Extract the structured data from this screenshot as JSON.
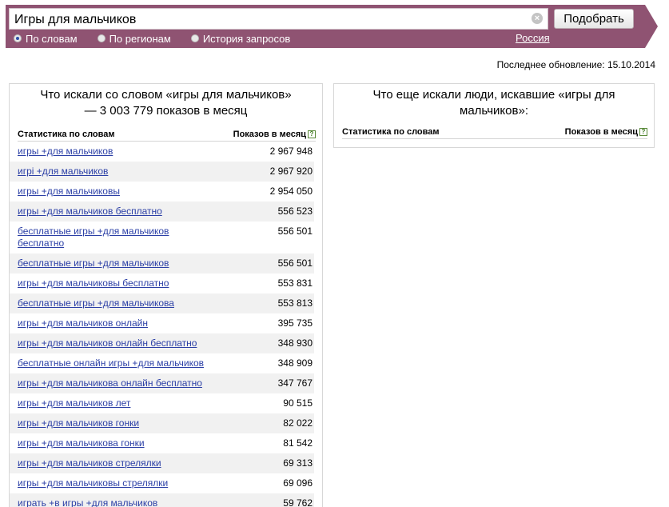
{
  "search": {
    "value": "Игры для мальчиков",
    "clear_icon": "×",
    "submit_label": "Подобрать"
  },
  "tabs": [
    {
      "label": "По словам",
      "checked": true
    },
    {
      "label": "По регионам",
      "checked": false
    },
    {
      "label": "История запросов",
      "checked": false
    }
  ],
  "region": "Россия",
  "last_update": "Последнее обновление: 15.10.2014",
  "left_panel": {
    "title": "Что искали со словом «игры для мальчиков» — 3 003 779 показов в месяц",
    "col_stats": "Статистика по словам",
    "col_shows": "Показов в месяц",
    "help": "?",
    "rows": [
      {
        "phrase": "игры +для мальчиков",
        "count": "2 967 948"
      },
      {
        "phrase": "игрi +для мальчиков",
        "count": "2 967 920"
      },
      {
        "phrase": "игры +для мальчиковы",
        "count": "2 954 050"
      },
      {
        "phrase": "игры +для мальчиков бесплатно",
        "count": "556 523"
      },
      {
        "phrase": "бесплатные игры +для мальчиков бесплатно",
        "count": "556 501"
      },
      {
        "phrase": "бесплатные игры +для мальчиков",
        "count": "556 501"
      },
      {
        "phrase": "игры +для мальчиковы бесплатно",
        "count": "553 831"
      },
      {
        "phrase": "бесплатные игры +для мальчикова",
        "count": "553 813"
      },
      {
        "phrase": "игры +для мальчиков онлайн",
        "count": "395 735"
      },
      {
        "phrase": "игры +для мальчиков онлайн бесплатно",
        "count": "348 930"
      },
      {
        "phrase": "бесплатные онлайн игры +для мальчиков",
        "count": "348 909"
      },
      {
        "phrase": "игры +для мальчикова онлайн бесплатно",
        "count": "347 767"
      },
      {
        "phrase": "игры +для мальчиков лет",
        "count": "90 515"
      },
      {
        "phrase": "игры +для мальчиков гонки",
        "count": "82 022"
      },
      {
        "phrase": "игры +для мальчикова гонки",
        "count": "81 542"
      },
      {
        "phrase": "игры +для мальчиков стрелялки",
        "count": "69 313"
      },
      {
        "phrase": "игры +для мальчиковы стрелялки",
        "count": "69 096"
      },
      {
        "phrase": "играть +в игры +для мальчиков",
        "count": "59 762"
      }
    ]
  },
  "right_panel": {
    "title": "Что еще искали люди, искавшие «игры для мальчиков»:",
    "col_stats": "Статистика по словам",
    "col_shows": "Показов в месяц",
    "help": "?"
  },
  "colors": {
    "header": "#8f5372",
    "link": "#2b3fa6",
    "row_stripe": "#f1f1f1"
  }
}
